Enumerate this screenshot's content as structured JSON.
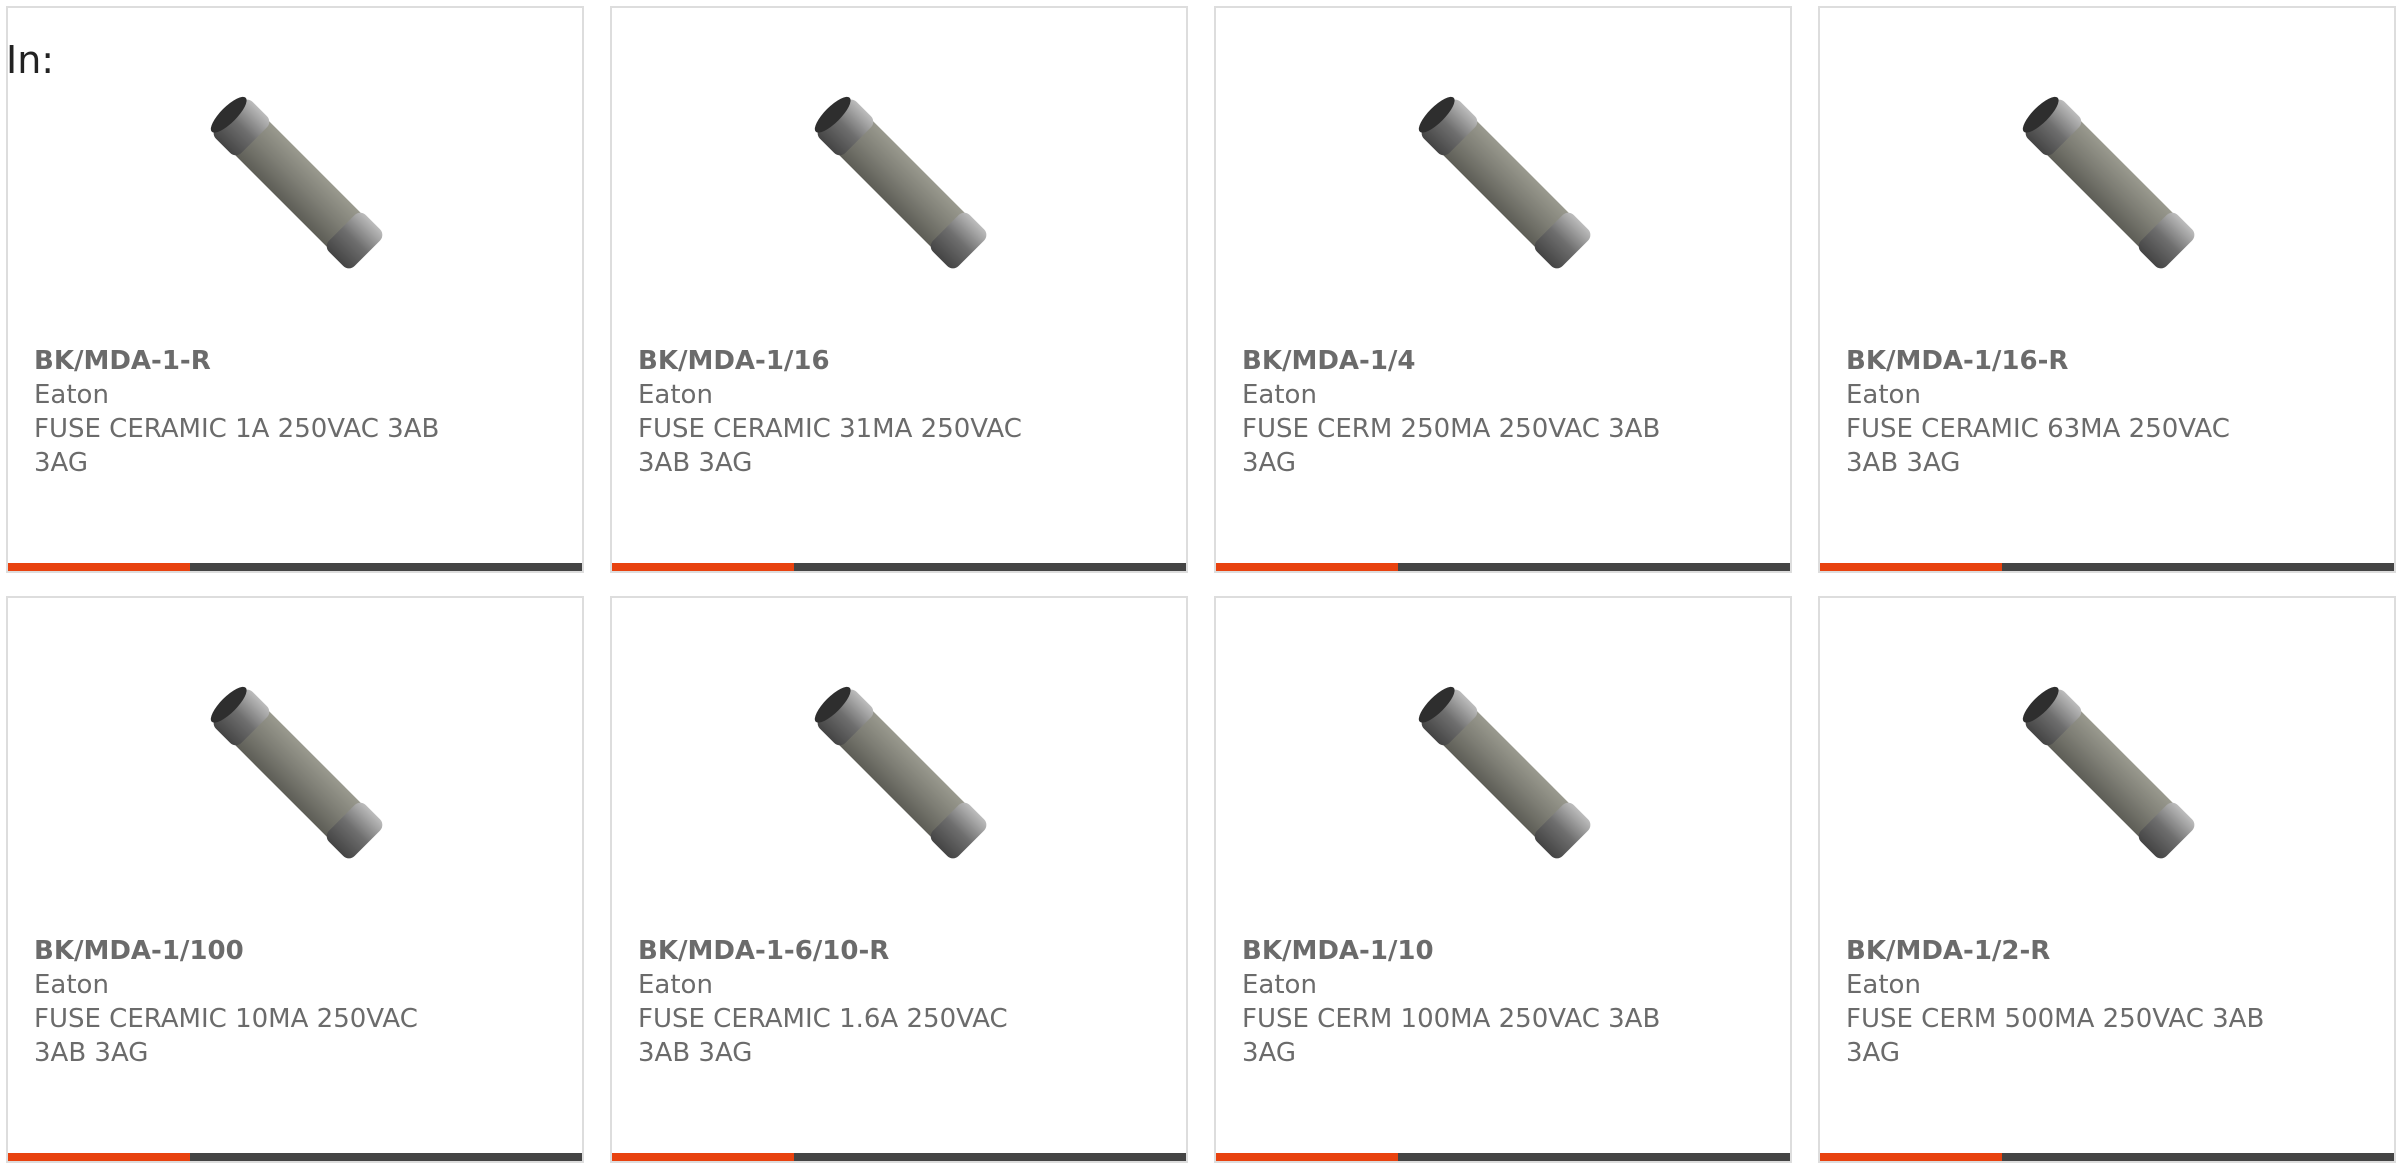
{
  "header": {
    "in_label": "In:"
  },
  "colors": {
    "accent": "#e8420f",
    "bar": "#444444",
    "text": "#6b6b6b",
    "border": "#dddddd"
  },
  "products": [
    {
      "part_number": "BK/MDA-1-R",
      "manufacturer": "Eaton",
      "description": "FUSE CERAMIC 1A 250VAC 3AB 3AG",
      "image_icon": "ceramic-fuse-icon"
    },
    {
      "part_number": "BK/MDA-1/16",
      "manufacturer": "Eaton",
      "description": "FUSE CERAMIC 31MA 250VAC 3AB 3AG",
      "image_icon": "ceramic-fuse-icon"
    },
    {
      "part_number": "BK/MDA-1/4",
      "manufacturer": "Eaton",
      "description": "FUSE CERM 250MA 250VAC 3AB 3AG",
      "image_icon": "ceramic-fuse-icon"
    },
    {
      "part_number": "BK/MDA-1/16-R",
      "manufacturer": "Eaton",
      "description": "FUSE CERAMIC 63MA 250VAC 3AB 3AG",
      "image_icon": "ceramic-fuse-icon"
    },
    {
      "part_number": "BK/MDA-1/100",
      "manufacturer": "Eaton",
      "description": "FUSE CERAMIC 10MA 250VAC 3AB 3AG",
      "image_icon": "ceramic-fuse-icon"
    },
    {
      "part_number": "BK/MDA-1-6/10-R",
      "manufacturer": "Eaton",
      "description": "FUSE CERAMIC 1.6A 250VAC 3AB 3AG",
      "image_icon": "ceramic-fuse-icon"
    },
    {
      "part_number": "BK/MDA-1/10",
      "manufacturer": "Eaton",
      "description": "FUSE CERM 100MA 250VAC 3AB 3AG",
      "image_icon": "ceramic-fuse-icon"
    },
    {
      "part_number": "BK/MDA-1/2-R",
      "manufacturer": "Eaton",
      "description": "FUSE CERM 500MA 250VAC 3AB 3AG",
      "image_icon": "ceramic-fuse-icon"
    }
  ]
}
